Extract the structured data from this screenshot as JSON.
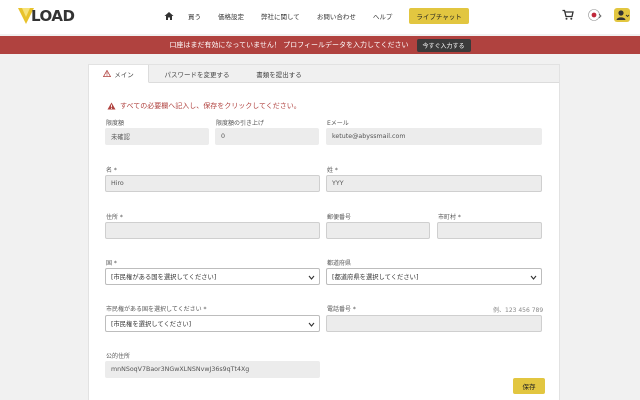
{
  "header": {
    "logo_text": "LOAD",
    "nav": [
      "買う",
      "価格設定",
      "弊社に関して",
      "お問い合わせ",
      "ヘルプ"
    ],
    "chat_label": "ライブチャット"
  },
  "alert": {
    "text": "口座はまだ有効になっていません！ プロフィールデータを入力してください",
    "button": "今すぐ入力する"
  },
  "tabs": [
    "メイン",
    "パスワードを変更する",
    "書類を提出する"
  ],
  "warning": "すべての必要欄へ記入し、保存をクリックしてください。",
  "form": {
    "limit_label": "限度額",
    "limit_value": "未確認",
    "raise_label": "限度額の引き上げ",
    "raise_value": "0",
    "email_label": "Eメール",
    "email_value": "ketute@abyssmail.com",
    "first_name_label": "名 *",
    "first_name_value": "Hiro",
    "last_name_label": "姓 *",
    "last_name_value": "YYY",
    "address_label": "住所 *",
    "address_value": "",
    "postcode_label": "郵便番号",
    "postcode_value": "",
    "city_label": "市町村 *",
    "city_value": "",
    "country_label": "国 *",
    "country_value": "[市民権がある国を選択してください]",
    "prefecture_label": "都道府県",
    "prefecture_value": "[都道府県を選択してください]",
    "citizenship_label": "市民権がある国を選択してください *",
    "citizenship_value": "[市民権を選択してください]",
    "phone_label": "電話番号 *",
    "phone_placeholder": "例、123 456 789",
    "phone_value": "",
    "wallet_label": "公的住所",
    "wallet_value": "mnNSoqV7Baor3NGwXLNSNvwJ36s9qTt4Xg"
  },
  "save_label": "保存",
  "colors": {
    "accent": "#e2c640",
    "alert_bg": "#b0423f",
    "warning": "#b0423f"
  }
}
